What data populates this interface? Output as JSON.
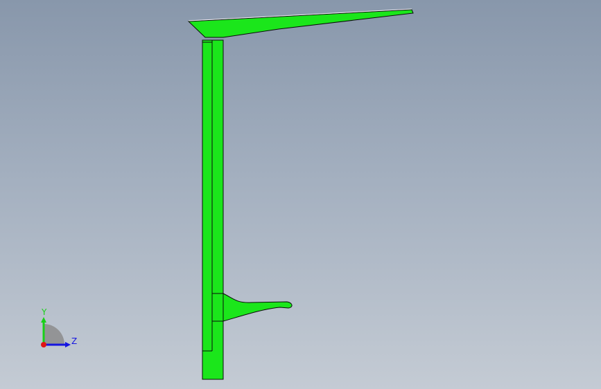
{
  "viewport": {
    "model_color": "#1be61b",
    "edge_color": "#0a0a0a",
    "background_top": "#8897ab",
    "background_bottom": "#c4cbd4"
  },
  "triad": {
    "y_label": "Y",
    "z_label": "Z",
    "y_color": "#18d018",
    "z_color": "#1515e0",
    "origin_color": "#e01515"
  }
}
